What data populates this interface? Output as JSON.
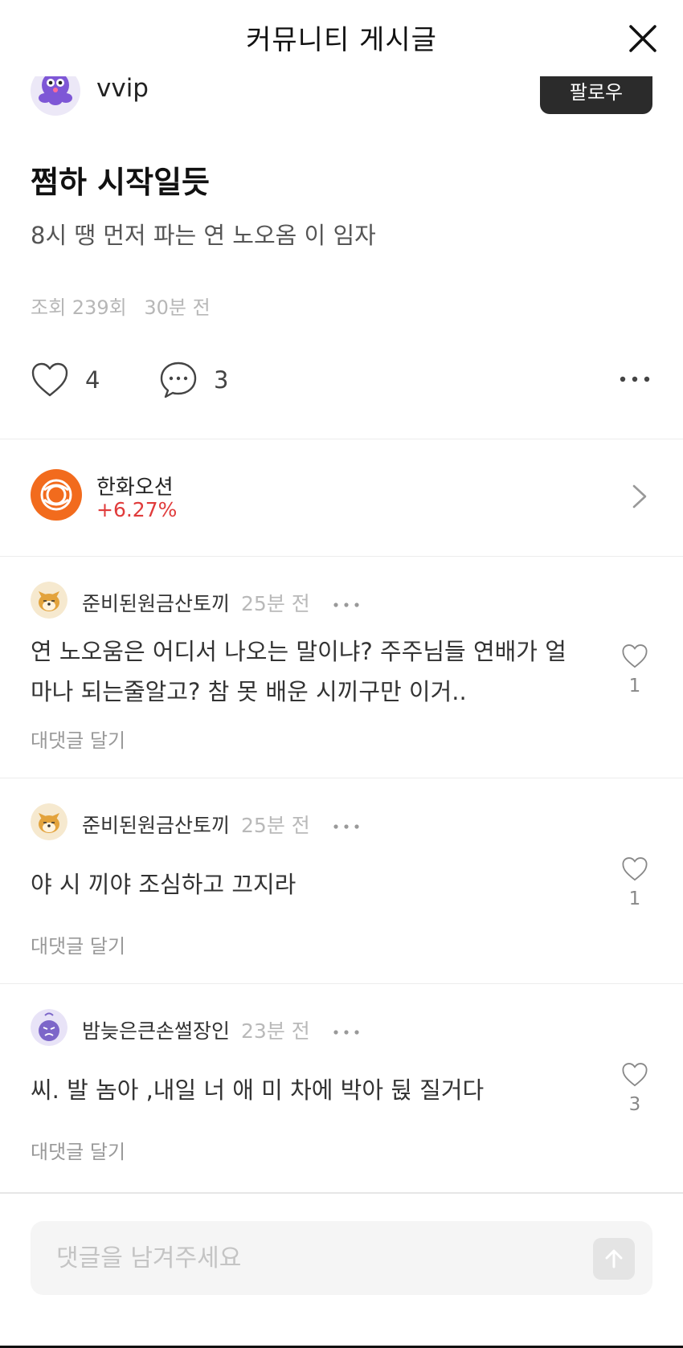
{
  "header": {
    "title": "커뮤니티 게시글",
    "close_icon": "close-icon"
  },
  "author": {
    "name": "vvip",
    "follow_label": "팔로우"
  },
  "post": {
    "title": "쩜하 시작일듯",
    "body": "8시 땡 먼저 파는 연 노오옴 이 임자",
    "views": "조회 239회",
    "time": "30분 전",
    "like_count": "4",
    "comment_count": "3"
  },
  "stock": {
    "name": "한화오션",
    "change": "+6.27%",
    "change_color": "#e03b3b",
    "logo_color": "#f26b1d"
  },
  "comments": [
    {
      "user": "준비된원금산토끼",
      "time": "25분 전",
      "text_line1": "연 노오움은 어디서 나오는 말이냐? 주주님들 연배가 얼",
      "text_line2": "마나 되는줄알고? 참 못 배운 시끼구만 이거..",
      "likes": "1",
      "reply_label": "대댓글 달기"
    },
    {
      "user": "준비된원금산토끼",
      "time": "25분 전",
      "text_line1": "야 시 끼야 조심하고 끄지라",
      "likes": "1",
      "reply_label": "대댓글 달기"
    },
    {
      "user": "밤늦은큰손썰장인",
      "time": "23분 전",
      "text_line1": "씨. 발 놈아 ,내일 너 애 미 차에 박아 뒩 질거다",
      "likes": "3",
      "reply_label": "대댓글 달기"
    }
  ],
  "input": {
    "placeholder": "댓글을 남겨주세요",
    "value": ""
  }
}
